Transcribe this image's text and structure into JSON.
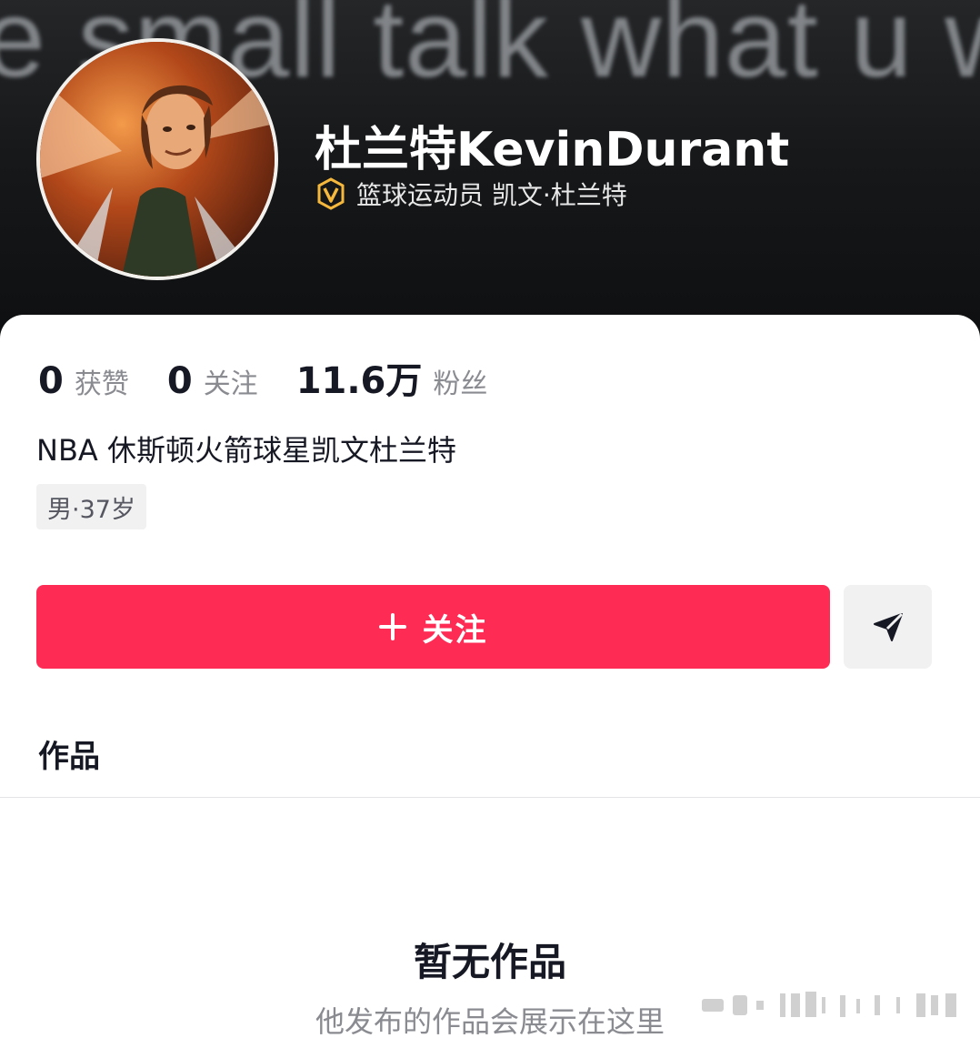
{
  "banner": {
    "background_text": "e small talk what u w"
  },
  "profile": {
    "name": "杜兰特KevinDurant",
    "verification_icon": "v-badge-icon",
    "verification_text": "篮球运动员 凯文·杜兰特",
    "avatar_icon": "avatar-image"
  },
  "stats": [
    {
      "value": "0",
      "label": "获赞"
    },
    {
      "value": "0",
      "label": "关注"
    },
    {
      "value": "11.6万",
      "label": "粉丝"
    }
  ],
  "bio": "NBA 休斯顿火箭球星凯文杜兰特",
  "tag": "男·37岁",
  "actions": {
    "follow_label": "关注",
    "follow_icon": "plus-icon",
    "share_icon": "send-icon"
  },
  "tabs": {
    "works": "作品"
  },
  "empty_state": {
    "title": "暂无作品",
    "subtitle": "他发布的作品会展示在这里"
  },
  "colors": {
    "accent": "#fe2c55",
    "text_primary": "#161823",
    "text_secondary": "#8a8b91",
    "verify_gold": "#f5b83d"
  }
}
